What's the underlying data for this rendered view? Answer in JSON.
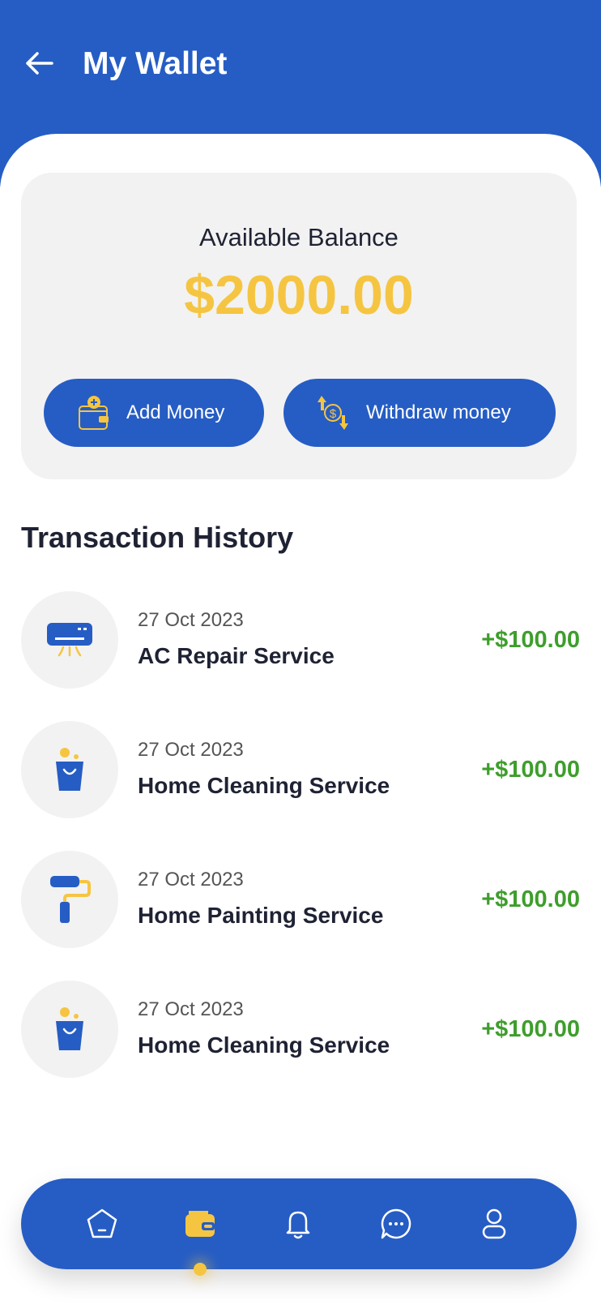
{
  "header": {
    "title": "My Wallet"
  },
  "balance": {
    "label": "Available Balance",
    "amount": "$2000.00",
    "add_label": "Add Money",
    "withdraw_label": "Withdraw money"
  },
  "history": {
    "title": "Transaction History",
    "items": [
      {
        "date": "27 Oct 2023",
        "name": "AC Repair Service",
        "amount": "+$100.00",
        "icon": "ac-icon"
      },
      {
        "date": "27 Oct 2023",
        "name": "Home Cleaning Service",
        "amount": "+$100.00",
        "icon": "cleaning-bucket-icon"
      },
      {
        "date": "27 Oct 2023",
        "name": "Home Painting Service",
        "amount": "+$100.00",
        "icon": "paint-roller-icon"
      },
      {
        "date": "27 Oct 2023",
        "name": "Home Cleaning Service",
        "amount": "+$100.00",
        "icon": "cleaning-bucket-icon"
      }
    ]
  },
  "nav": {
    "items": [
      "home-icon",
      "wallet-icon",
      "bell-icon",
      "chat-icon",
      "profile-icon"
    ],
    "active": "wallet-icon"
  },
  "colors": {
    "primary": "#265DC4",
    "accent": "#F5C542",
    "positive": "#3E9E2C",
    "card": "#F2F2F2"
  }
}
